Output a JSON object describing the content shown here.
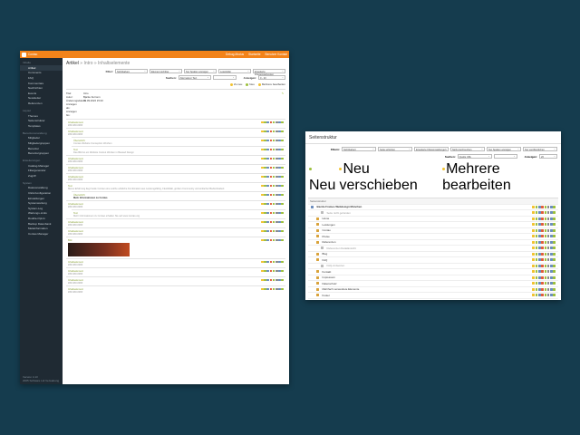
{
  "win1": {
    "topbar": {
      "app": "Contao",
      "links": [
        "Debug-Modus",
        "Startseite",
        "Benutzer Kontakt"
      ]
    },
    "side": {
      "groups": [
        {
          "title": "Inhalte",
          "items": [
            "Artikel",
            "Comments",
            "FAQ",
            "Kommentare",
            "Nachrichten",
            "Events",
            "Newsletter",
            "Referenzen"
          ]
        },
        {
          "title": "Layout",
          "items": [
            "Themes",
            "Seitenstruktur",
            "Templates"
          ]
        },
        {
          "title": "Benutzerverwaltung",
          "items": [
            "Mitglieder",
            "Mitgliedergruppen",
            "Benutzer",
            "Benutzergruppen"
          ]
        },
        {
          "title": "Erweiterungen",
          "items": [
            "Catalog-Manager",
            "Filtergenerator",
            "Zugriff"
          ]
        },
        {
          "title": "System",
          "items": [
            "Dateiverwaltung",
            "Click-Konfiguration",
            "Einstellungen",
            "Systemwartung",
            "System-Log",
            "Wartungs-Links",
            "Double-Opt-In",
            "Backup Datenbank",
            "Metainformation",
            "Contao Manager"
          ]
        }
      ],
      "active": "Artikel",
      "footer": [
        "Version 4.13",
        "2005 Software Ltd Verwaltung"
      ]
    },
    "heading": {
      "title": "Artikel",
      "crumb": "» Intro » Inhaltselemente"
    },
    "filters": {
      "label": "Filter:",
      "selects": [
        "Sichtbarkeit",
        "Element sichtbar",
        "Nur Spalten anzeigen",
        "Lesefelder",
        "Erweiterte Filtereinstellungen"
      ],
      "search_label": "Suchen:",
      "search_select": "Alternativer Text",
      "view_label": "Anzeigen:",
      "view_select": "0 - 20"
    },
    "legend": [
      "Zu neu",
      "Neu",
      "Mehrere bearbeiten"
    ],
    "meta": [
      [
        "Titel:",
        "Intro"
      ],
      [
        "Autor:",
        "Bjarke Ferronn"
      ],
      [
        "Änderungsdatum:",
        "09.09.2022 15:20"
      ],
      [
        "Anzeigen als:",
        ""
      ],
      [
        "Anzeigen bis:",
        ""
      ]
    ],
    "records": [
      {
        "t": "Inhaltselement",
        "d": "###-###-####",
        "b": "",
        "nest": false
      },
      {
        "t": "Inhaltselement",
        "d": "###-###-####",
        "b": "",
        "nest": false
      },
      {
        "t": "Überschrift",
        "d": "Contao Website Conception Wochen",
        "b": "",
        "nest": true
      },
      {
        "t": "Text",
        "d": "Das Bild ist ein Website Cuttout Werken in Bassed Design",
        "b": "",
        "nest": true
      },
      {
        "t": "Inhaltselement",
        "d": "###-###-####",
        "b": "",
        "nest": false
      },
      {
        "t": "Inhaltselement",
        "d": "###-###-####",
        "b": "",
        "nest": false
      },
      {
        "t": "Inhaltselement",
        "d": "###-###-####",
        "b": "",
        "nest": false
      },
      {
        "t": "Text",
        "d": "Meine Erfahrung liegt beide Contao eine solche wirkliche Kombination aus Leistungsfähig, Flexibilität, großen Community und einfacher Bedienbarkeit",
        "b": "",
        "nest": false
      },
      {
        "t": "Überschrift",
        "d": "",
        "b": "Mehr Informationen zu Contao",
        "nest": true
      },
      {
        "t": "Inhaltselement",
        "d": "###-###-####",
        "b": "",
        "nest": false
      },
      {
        "t": "Text",
        "d": "Mehr Informationen zu Contao erhalten Sie auf www.contao.org",
        "b": "",
        "nest": true
      },
      {
        "t": "Inhaltselement",
        "d": "###-###-####",
        "b": "",
        "nest": false
      },
      {
        "t": "Inhaltselement",
        "d": "###-###-####",
        "b": "",
        "nest": false
      },
      {
        "t": "Bild",
        "d": "",
        "b": "",
        "nest": false,
        "img": true
      },
      {
        "t": "Inhaltselement",
        "d": "###-###-####",
        "b": "",
        "nest": false
      },
      {
        "t": "Inhaltselement",
        "d": "###-###-####",
        "b": "",
        "nest": false
      },
      {
        "t": "Inhaltselement",
        "d": "###-###-####",
        "b": "",
        "nest": false
      },
      {
        "t": "Inhaltselement",
        "d": "###-###-####",
        "b": "",
        "nest": false
      }
    ]
  },
  "win2": {
    "title": "Seitenstruktur",
    "filters": {
      "label": "Filtern:",
      "selects": [
        "Sichtbarkeit",
        "Seite schützen",
        "Erweiterte Filtereinstellungen",
        "Nicht durchsuchen",
        "Nur Spalten anzeigen",
        "Nur veröffentlichen"
      ],
      "search_label": "Suchen:",
      "search_select": "Quelle URL",
      "view_label": "Anzeigen:",
      "view_select": "20"
    },
    "legend": [
      "Neu",
      "Neu verschieben",
      "Mehrere bearbeiten"
    ],
    "tree_header": "Seitenstruktur",
    "tree": [
      {
        "label": "Bazzle Frames Webdesign München",
        "cls": "root"
      },
      {
        "label": "Seite nicht gefunden",
        "cls": "muted"
      },
      {
        "label": "Home",
        "cls": ""
      },
      {
        "label": "Leistungen",
        "cls": ""
      },
      {
        "label": "Contao",
        "cls": ""
      },
      {
        "label": "Preise",
        "cls": ""
      },
      {
        "label": "Referenzen",
        "cls": ""
      },
      {
        "label": "Referenzen Detailansicht",
        "cls": "muted"
      },
      {
        "label": "Blog",
        "cls": ""
      },
      {
        "label": "FAQ",
        "cls": ""
      },
      {
        "label": "FAQ-Antworten",
        "cls": "muted"
      },
      {
        "label": "Kontakt",
        "cls": ""
      },
      {
        "label": "Impressum",
        "cls": ""
      },
      {
        "label": "Datenschutz",
        "cls": ""
      },
      {
        "label": "Mehrfach verwendete Elemente",
        "cls": ""
      },
      {
        "label": "Footer",
        "cls": ""
      },
      {
        "label": "Kontakt (top-link)",
        "cls": ""
      }
    ]
  }
}
